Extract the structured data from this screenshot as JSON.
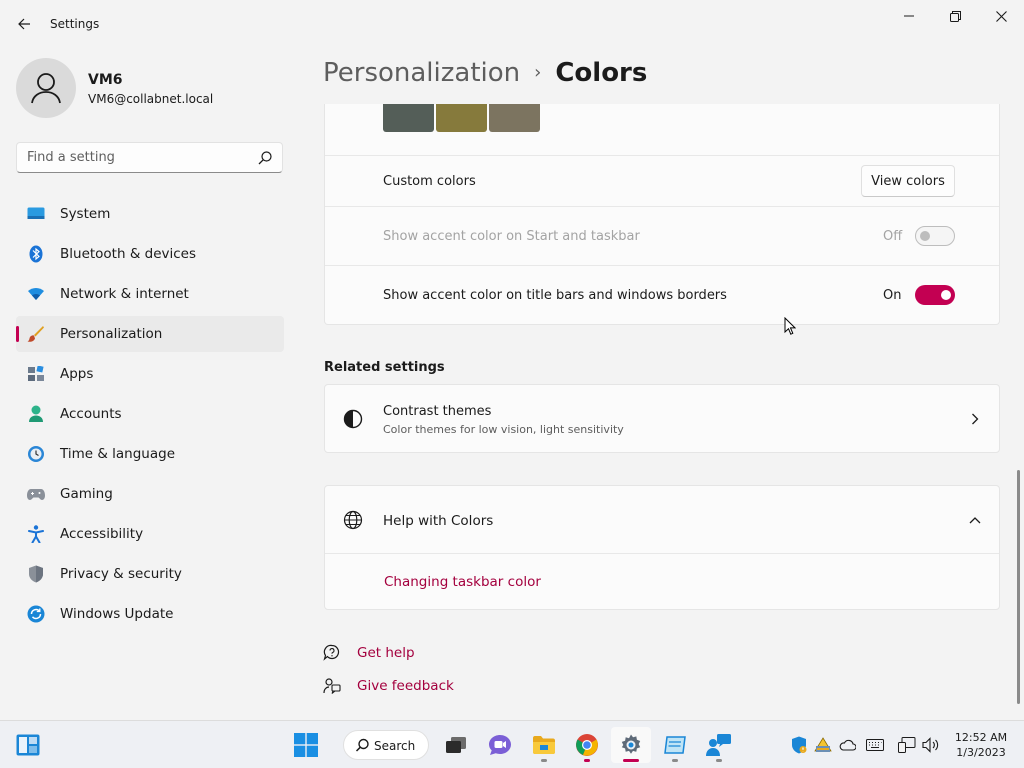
{
  "window": {
    "title": "Settings"
  },
  "profile": {
    "name": "VM6",
    "email": "VM6@collabnet.local"
  },
  "search": {
    "placeholder": "Find a setting"
  },
  "sidebar": {
    "items": [
      {
        "label": "System",
        "icon": "system-icon"
      },
      {
        "label": "Bluetooth & devices",
        "icon": "bluetooth-icon"
      },
      {
        "label": "Network & internet",
        "icon": "wifi-icon"
      },
      {
        "label": "Personalization",
        "icon": "brush-icon",
        "active": true
      },
      {
        "label": "Apps",
        "icon": "apps-icon"
      },
      {
        "label": "Accounts",
        "icon": "accounts-icon"
      },
      {
        "label": "Time & language",
        "icon": "clock-icon"
      },
      {
        "label": "Gaming",
        "icon": "gamepad-icon"
      },
      {
        "label": "Accessibility",
        "icon": "accessibility-icon"
      },
      {
        "label": "Privacy & security",
        "icon": "shield-icon"
      },
      {
        "label": "Windows Update",
        "icon": "update-icon"
      }
    ]
  },
  "breadcrumb": {
    "parent": "Personalization",
    "separator": "›",
    "current": "Colors"
  },
  "colors": {
    "swatches": [
      "#545e58",
      "#867a3c",
      "#7c7460"
    ],
    "custom_colors_label": "Custom colors",
    "view_colors_button": "View colors",
    "accent_start_label": "Show accent color on Start and taskbar",
    "accent_start_state": "Off",
    "accent_titlebar_label": "Show accent color on title bars and windows borders",
    "accent_titlebar_state": "On",
    "accent_color": "#c30052"
  },
  "related": {
    "title": "Related settings",
    "contrast_title": "Contrast themes",
    "contrast_subtitle": "Color themes for low vision, light sensitivity"
  },
  "help": {
    "title": "Help with Colors",
    "link": "Changing taskbar color"
  },
  "footer": {
    "get_help": "Get help",
    "give_feedback": "Give feedback"
  },
  "taskbar": {
    "search_label": "Search",
    "time": "12:52 AM",
    "date": "1/3/2023"
  }
}
